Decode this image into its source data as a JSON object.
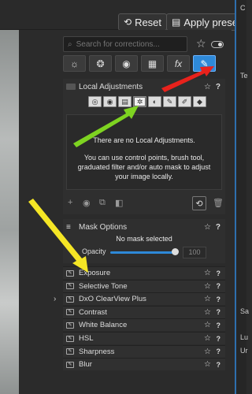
{
  "toolbar": {
    "reset_label": "Reset",
    "apply_preset_label": "Apply preset"
  },
  "search": {
    "placeholder": "Search for corrections..."
  },
  "tabs": [
    {
      "icon": "sun-icon",
      "glyph": "☼"
    },
    {
      "icon": "color-circles-icon",
      "glyph": "❂"
    },
    {
      "icon": "detail-icon",
      "glyph": "◉"
    },
    {
      "icon": "geometry-icon",
      "glyph": "▦"
    },
    {
      "icon": "fx-icon",
      "glyph": "fx"
    },
    {
      "icon": "local-adjust-icon",
      "glyph": "✎"
    }
  ],
  "local_adjustments": {
    "title": "Local Adjustments",
    "tools": [
      "◎",
      "◉",
      "▤",
      "✲",
      "◐",
      "✎",
      "✐",
      "◆"
    ],
    "message_title": "There are no Local Adjustments.",
    "message_body": "You can use control points, brush tool, graduated filter and/or auto mask to adjust your image locally."
  },
  "mask_options": {
    "title": "Mask Options",
    "no_mask_text": "No mask selected",
    "opacity_label": "Opacity",
    "opacity_value": "100",
    "opacity_level": 1.0
  },
  "corrections": [
    "Exposure",
    "Selective Tone",
    "DxO ClearView Plus",
    "Contrast",
    "White Balance",
    "HSL",
    "Sharpness",
    "Blur"
  ],
  "right_panel": {
    "text_te": "Te",
    "text_sa": "Sa",
    "text_lu": "Lu",
    "text_ur": "Ur",
    "text_c": "C"
  },
  "colors": {
    "accent": "#2e89d8",
    "green_arrow": "#7ed321",
    "red_arrow": "#e8221c",
    "yellow_arrow": "#f5e625"
  }
}
